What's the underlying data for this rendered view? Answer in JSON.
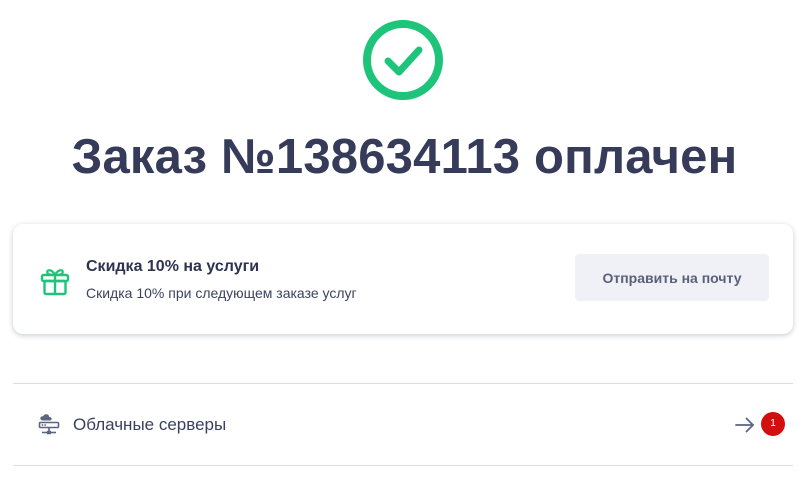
{
  "status": {
    "icon": "check-circle-icon",
    "color": "#1fc47b"
  },
  "title": "Заказ №138634113 оплачен",
  "promo": {
    "icon": "gift-icon",
    "icon_color": "#1fc47b",
    "title": "Скидка 10% на услуги",
    "subtitle": "Скидка 10% при следующем заказе услуг",
    "button_label": "Отправить на почту"
  },
  "service": {
    "icon": "cloud-server-icon",
    "label": "Облачные серверы",
    "arrow_icon": "arrow-right-icon",
    "badge_count": "1",
    "badge_color": "#d10f0f"
  }
}
